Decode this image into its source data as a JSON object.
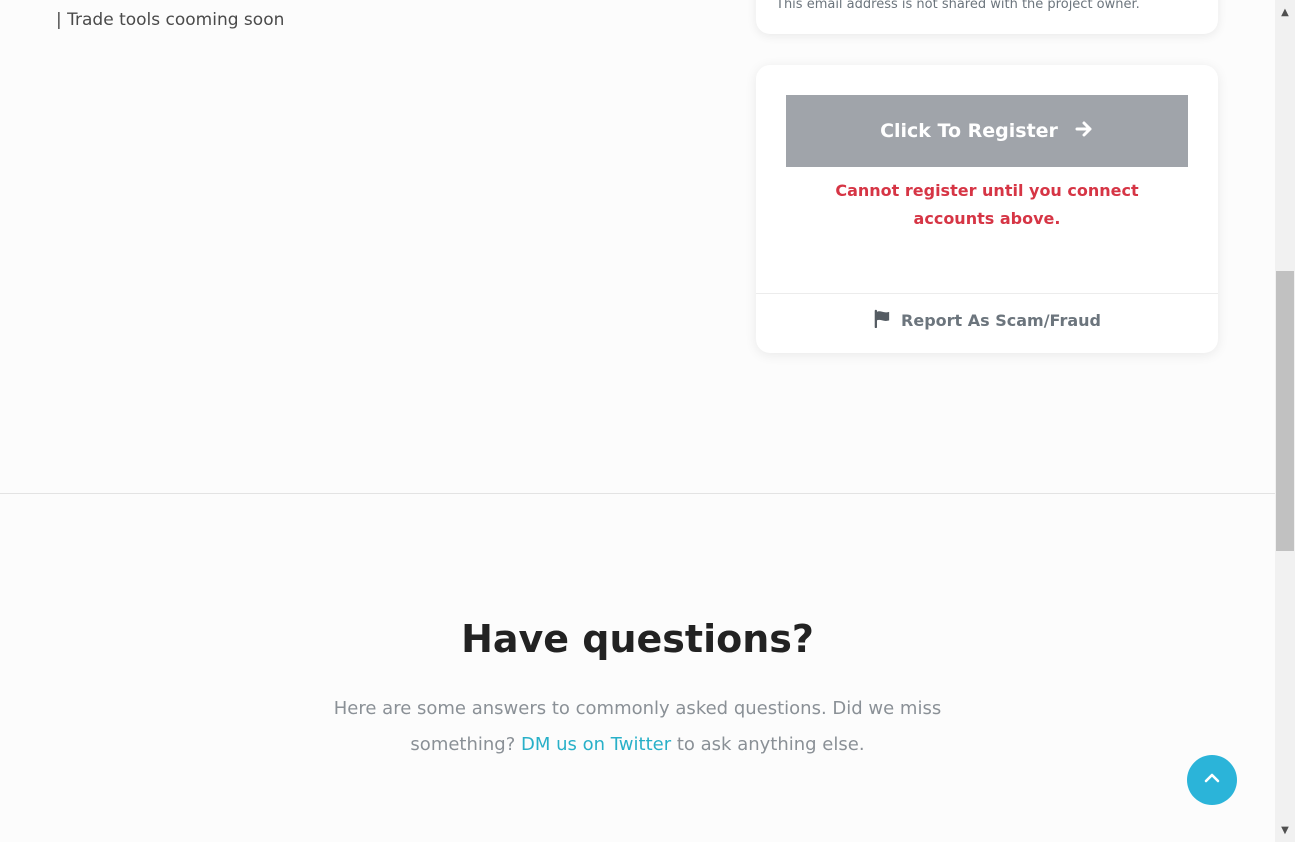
{
  "project": {
    "description_line": "| Trade tools cooming soon"
  },
  "email_card": {
    "note": "This email address is not shared with the project owner."
  },
  "register_card": {
    "register_label": "Click To Register",
    "register_enabled": false,
    "error_message": "Cannot register until you connect accounts above.",
    "report_label": "Report As Scam/Fraud"
  },
  "faq": {
    "title": "Have questions?",
    "subtitle_before": "Here are some answers to commonly asked questions. Did we miss something?",
    "subtitle_link": "DM us on Twitter",
    "subtitle_after": "to ask anything else."
  },
  "icons": {
    "register": "arrow-right-icon",
    "report": "flag-icon",
    "scroll_top": "chevron-up-icon"
  },
  "colors": {
    "accent": "#2bb4d9",
    "link": "#28b0c8",
    "error": "#d63545",
    "disabled_button": "#a0a4aa"
  }
}
